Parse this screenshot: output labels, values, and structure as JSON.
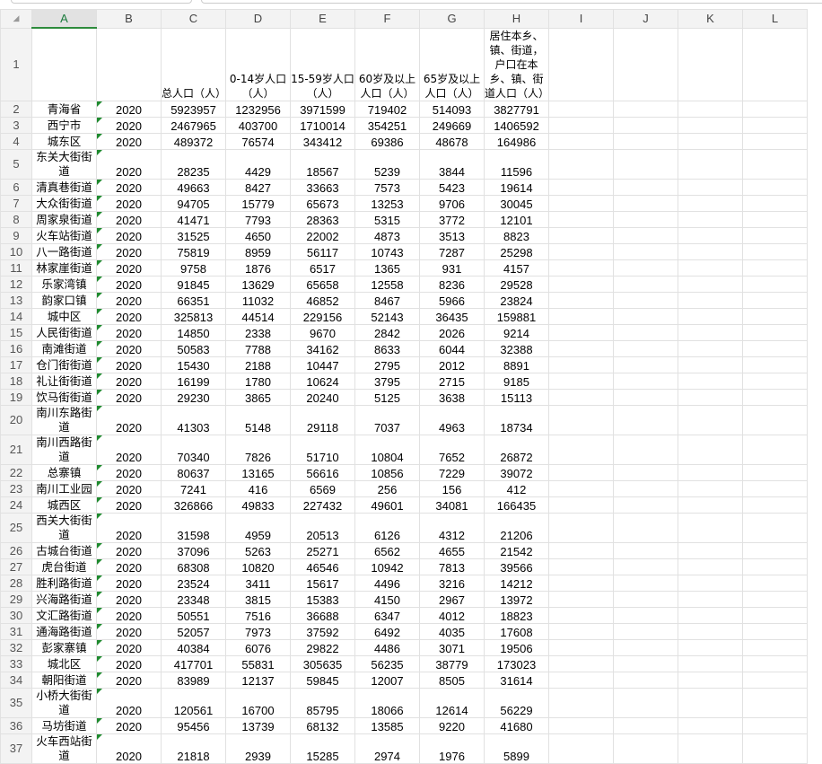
{
  "columns": [
    "A",
    "B",
    "C",
    "D",
    "E",
    "F",
    "G",
    "H",
    "I",
    "J",
    "K",
    "L"
  ],
  "header_row": [
    "",
    "",
    "总人口（人）",
    "0-14岁人口（人）",
    "15-59岁人口（人）",
    "60岁及以上人口（人）",
    "65岁及以上人口（人）",
    "居住本乡、镇、街道，户口在本乡、镇、街道人口（人）"
  ],
  "rows": [
    [
      "青海省",
      "2020",
      "5923957",
      "1232956",
      "3971599",
      "719402",
      "514093",
      "3827791"
    ],
    [
      "西宁市",
      "2020",
      "2467965",
      "403700",
      "1710014",
      "354251",
      "249669",
      "1406592"
    ],
    [
      "城东区",
      "2020",
      "489372",
      "76574",
      "343412",
      "69386",
      "48678",
      "164986"
    ],
    [
      "东关大街街道",
      "2020",
      "28235",
      "4429",
      "18567",
      "5239",
      "3844",
      "11596"
    ],
    [
      "清真巷街道",
      "2020",
      "49663",
      "8427",
      "33663",
      "7573",
      "5423",
      "19614"
    ],
    [
      "大众街街道",
      "2020",
      "94705",
      "15779",
      "65673",
      "13253",
      "9706",
      "30045"
    ],
    [
      "周家泉街道",
      "2020",
      "41471",
      "7793",
      "28363",
      "5315",
      "3772",
      "12101"
    ],
    [
      "火车站街道",
      "2020",
      "31525",
      "4650",
      "22002",
      "4873",
      "3513",
      "8823"
    ],
    [
      "八一路街道",
      "2020",
      "75819",
      "8959",
      "56117",
      "10743",
      "7287",
      "25298"
    ],
    [
      "林家崖街道",
      "2020",
      "9758",
      "1876",
      "6517",
      "1365",
      "931",
      "4157"
    ],
    [
      "乐家湾镇",
      "2020",
      "91845",
      "13629",
      "65658",
      "12558",
      "8236",
      "29528"
    ],
    [
      "韵家口镇",
      "2020",
      "66351",
      "11032",
      "46852",
      "8467",
      "5966",
      "23824"
    ],
    [
      "城中区",
      "2020",
      "325813",
      "44514",
      "229156",
      "52143",
      "36435",
      "159881"
    ],
    [
      "人民街街道",
      "2020",
      "14850",
      "2338",
      "9670",
      "2842",
      "2026",
      "9214"
    ],
    [
      "南滩街道",
      "2020",
      "50583",
      "7788",
      "34162",
      "8633",
      "6044",
      "32388"
    ],
    [
      "仓门街街道",
      "2020",
      "15430",
      "2188",
      "10447",
      "2795",
      "2012",
      "8891"
    ],
    [
      "礼让街街道",
      "2020",
      "16199",
      "1780",
      "10624",
      "3795",
      "2715",
      "9185"
    ],
    [
      "饮马街街道",
      "2020",
      "29230",
      "3865",
      "20240",
      "5125",
      "3638",
      "15113"
    ],
    [
      "南川东路街道",
      "2020",
      "41303",
      "5148",
      "29118",
      "7037",
      "4963",
      "18734"
    ],
    [
      "南川西路街道",
      "2020",
      "70340",
      "7826",
      "51710",
      "10804",
      "7652",
      "26872"
    ],
    [
      "总寨镇",
      "2020",
      "80637",
      "13165",
      "56616",
      "10856",
      "7229",
      "39072"
    ],
    [
      "南川工业园",
      "2020",
      "7241",
      "416",
      "6569",
      "256",
      "156",
      "412"
    ],
    [
      "城西区",
      "2020",
      "326866",
      "49833",
      "227432",
      "49601",
      "34081",
      "166435"
    ],
    [
      "西关大街街道",
      "2020",
      "31598",
      "4959",
      "20513",
      "6126",
      "4312",
      "21206"
    ],
    [
      "古城台街道",
      "2020",
      "37096",
      "5263",
      "25271",
      "6562",
      "4655",
      "21542"
    ],
    [
      "虎台街道",
      "2020",
      "68308",
      "10820",
      "46546",
      "10942",
      "7813",
      "39566"
    ],
    [
      "胜利路街道",
      "2020",
      "23524",
      "3411",
      "15617",
      "4496",
      "3216",
      "14212"
    ],
    [
      "兴海路街道",
      "2020",
      "23348",
      "3815",
      "15383",
      "4150",
      "2967",
      "13972"
    ],
    [
      "文汇路街道",
      "2020",
      "50551",
      "7516",
      "36688",
      "6347",
      "4012",
      "18823"
    ],
    [
      "通海路街道",
      "2020",
      "52057",
      "7973",
      "37592",
      "6492",
      "4035",
      "17608"
    ],
    [
      "彭家寨镇",
      "2020",
      "40384",
      "6076",
      "29822",
      "4486",
      "3071",
      "19506"
    ],
    [
      "城北区",
      "2020",
      "417701",
      "55831",
      "305635",
      "56235",
      "38779",
      "173023"
    ],
    [
      "朝阳街道",
      "2020",
      "83989",
      "12137",
      "59845",
      "12007",
      "8505",
      "31614"
    ],
    [
      "小桥大街街道",
      "2020",
      "120561",
      "16700",
      "85795",
      "18066",
      "12614",
      "56229"
    ],
    [
      "马坊街道",
      "2020",
      "95456",
      "13739",
      "68132",
      "13585",
      "9220",
      "41680"
    ],
    [
      "火车西站街道",
      "2020",
      "21818",
      "2939",
      "15285",
      "2974",
      "1976",
      "5899"
    ]
  ]
}
